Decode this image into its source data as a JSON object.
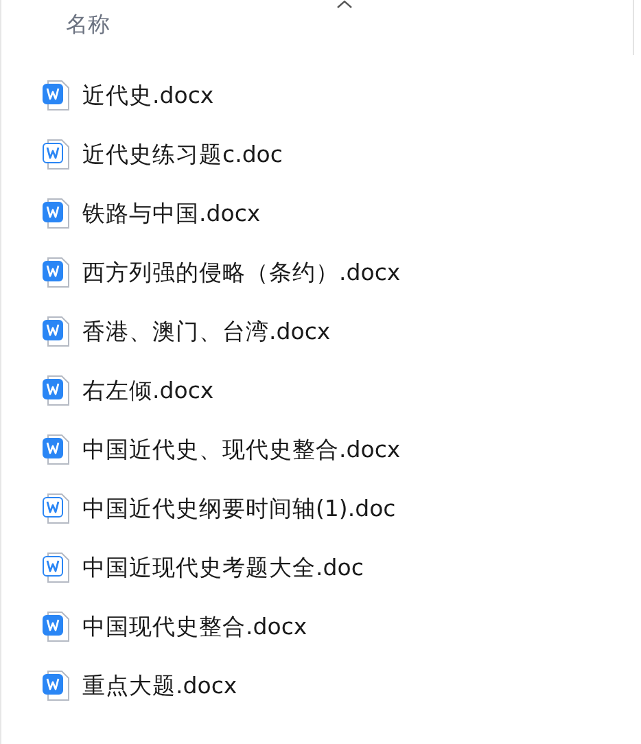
{
  "header": {
    "label": "名称"
  },
  "files": [
    {
      "name": "近代史.docx",
      "kind": "docx"
    },
    {
      "name": "近代史练习题c.doc",
      "kind": "doc"
    },
    {
      "name": "铁路与中国.docx",
      "kind": "docx"
    },
    {
      "name": "西方列强的侵略（条约）.docx",
      "kind": "docx"
    },
    {
      "name": "香港、澳门、台湾.docx",
      "kind": "docx"
    },
    {
      "name": "右左倾.docx",
      "kind": "docx"
    },
    {
      "name": "中国近代史、现代史整合.docx",
      "kind": "docx"
    },
    {
      "name": "中国近代史纲要时间轴(1).doc",
      "kind": "doc"
    },
    {
      "name": "中国近现代史考题大全.doc",
      "kind": "doc"
    },
    {
      "name": "中国现代史整合.docx",
      "kind": "docx"
    },
    {
      "name": "重点大题.docx",
      "kind": "docx"
    }
  ]
}
